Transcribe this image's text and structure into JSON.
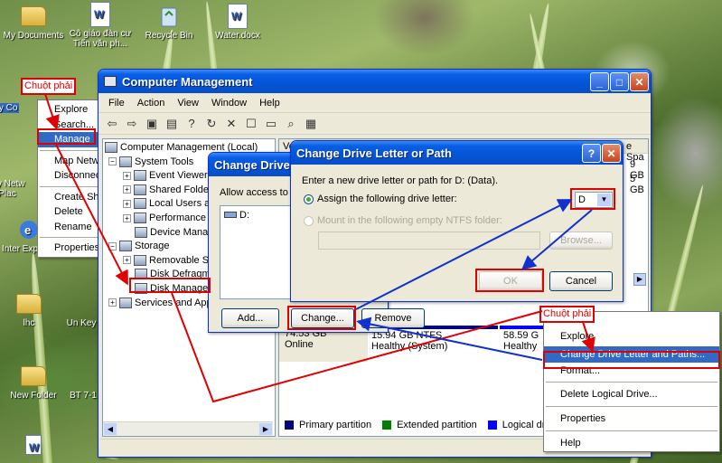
{
  "desktop": {
    "icons": [
      {
        "label": "My Documents",
        "icon": "folder-icon"
      },
      {
        "label": "Cô giáo đàn cư Tiến văn ph...",
        "icon": "word-document-icon"
      },
      {
        "label": "Recycle Bin",
        "icon": "recycle-bin-icon"
      },
      {
        "label": "Water.docx",
        "icon": "word-document-icon"
      },
      {
        "label": "My Co",
        "icon": "computer-icon"
      },
      {
        "label": "My Netw Plac",
        "icon": "network-icon"
      },
      {
        "label": "Inter Explorer",
        "icon": "internet-explorer-icon"
      },
      {
        "label": "lhc",
        "icon": "folder-icon"
      },
      {
        "label": "Un Key",
        "icon": "unikey-icon"
      },
      {
        "label": "New Folder",
        "icon": "folder-icon"
      },
      {
        "label": "BT 7-1",
        "icon": "document-icon"
      }
    ]
  },
  "context_menu_desktop": {
    "items": [
      "Explore",
      "Search...",
      "Manage",
      "Map Netw",
      "Disconnec",
      "Create Sh",
      "Delete",
      "Rename",
      "Properties"
    ],
    "selected": "Manage"
  },
  "annotations": {
    "right_click_label": "Chuột phải"
  },
  "computer_management": {
    "title": "Computer Management",
    "menu": [
      "File",
      "Action",
      "View",
      "Window",
      "Help"
    ],
    "tree": [
      {
        "label": "Computer Management (Local)",
        "level": 0
      },
      {
        "label": "System Tools",
        "level": 1
      },
      {
        "label": "Event Viewer",
        "level": 2
      },
      {
        "label": "Shared Folders",
        "level": 2
      },
      {
        "label": "Local Users and",
        "level": 2
      },
      {
        "label": "Performance",
        "level": 2
      },
      {
        "label": "Device Manager",
        "level": 2
      },
      {
        "label": "Storage",
        "level": 1
      },
      {
        "label": "Removable St",
        "level": 2
      },
      {
        "label": "Disk Defragm",
        "level": 2
      },
      {
        "label": "Disk Manager",
        "level": 2
      },
      {
        "label": "Services and App",
        "level": 1
      }
    ],
    "right_header_fragment": "Vo",
    "free_space_header": "e Spa",
    "free_space_values": [
      "9 GB",
      "5 GB"
    ],
    "disk_info": {
      "size": "74.53 GB",
      "status": "Online"
    },
    "partitions": [
      {
        "line1": "15.94 GB NTFS",
        "line2": "Healthy (System)"
      },
      {
        "line1": "58.59 G",
        "line2": "Healthy"
      }
    ],
    "legend": [
      {
        "label": "Primary partition",
        "color": "#000080"
      },
      {
        "label": "Extended partition",
        "color": "#008000"
      },
      {
        "label": "Logical drive",
        "color": "#0000ff"
      }
    ]
  },
  "change_drive_dialog_back": {
    "title": "Change Drive L",
    "allow_text": "Allow access to t",
    "list_item": "D:",
    "buttons": {
      "add": "Add...",
      "change": "Change...",
      "remove": "Remove"
    }
  },
  "change_drive_dialog": {
    "title": "Change Drive Letter or Path",
    "prompt": "Enter a new drive letter or path for D: (Data).",
    "option_assign": "Assign the following drive letter:",
    "option_mount": "Mount in the following empty NTFS folder:",
    "drive_letter": "D",
    "buttons": {
      "browse": "Browse...",
      "ok": "OK",
      "cancel": "Cancel"
    }
  },
  "partition_context_menu": {
    "items": [
      "Explore",
      "Change Drive Letter and Paths...",
      "Format...",
      "Delete Logical Drive...",
      "Properties",
      "Help"
    ],
    "selected": "Change Drive Letter and Paths..."
  }
}
